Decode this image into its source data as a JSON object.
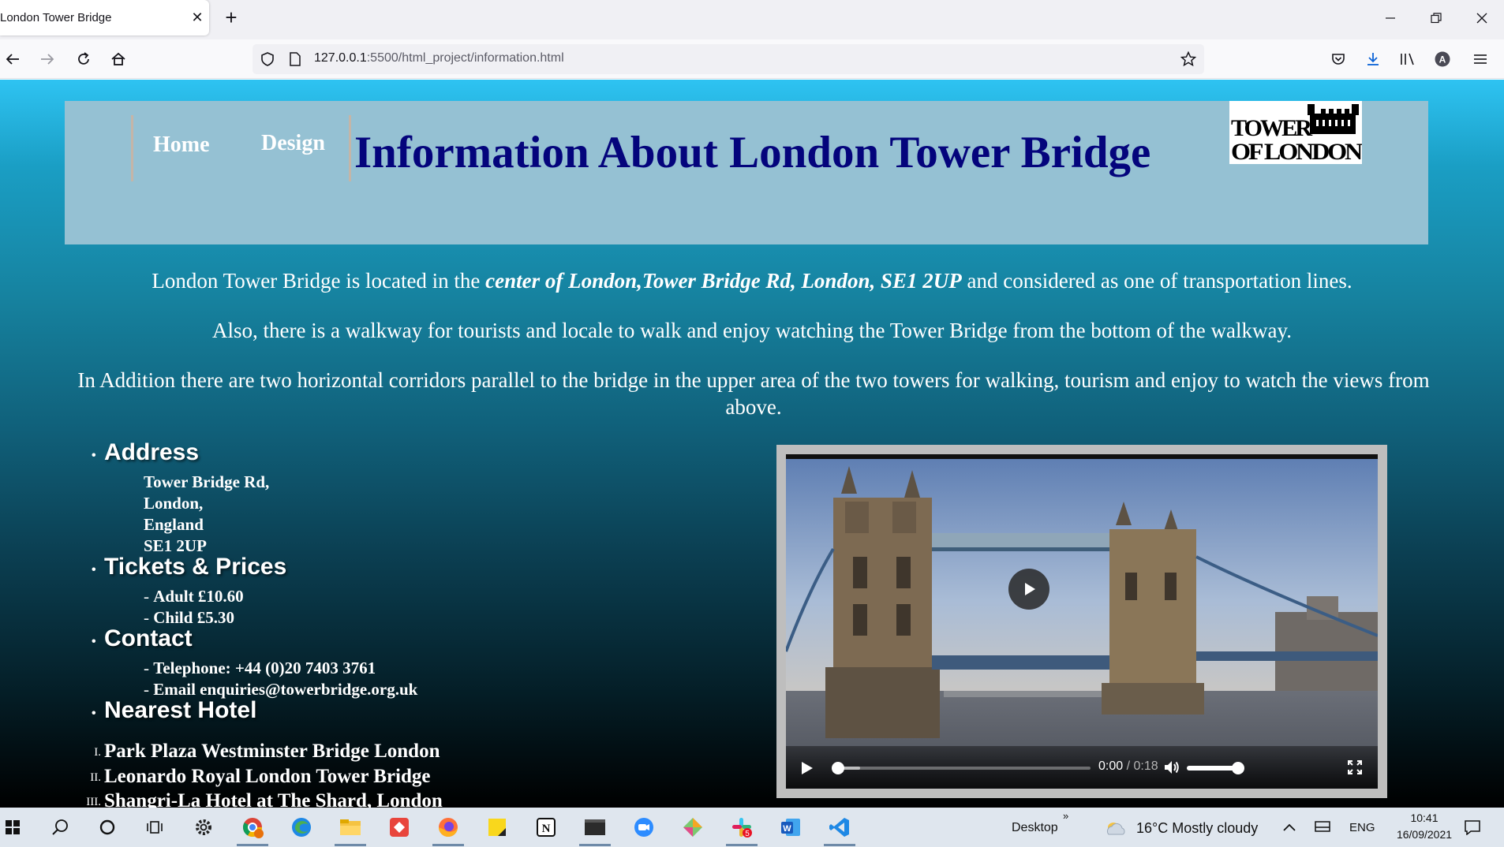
{
  "browser": {
    "tab_title": "London Tower Bridge",
    "tab_close": "✕",
    "new_tab": "+",
    "url_host": "127.0.0.1",
    "url_rest": ":5500/html_project/information.html"
  },
  "page": {
    "nav": {
      "home": "Home",
      "design": "Design"
    },
    "title": "Information About London Tower Bridge",
    "logo": {
      "line1": "TOWER",
      "line2": "OF LONDON"
    },
    "paragraphs": {
      "p1_start": "London Tower Bridge is located in the ",
      "p1_em": "center of London,Tower Bridge Rd, London, SE1 2UP",
      "p1_end": " and considered as one of transportation lines.",
      "p2": "Also, there is a walkway for tourists and locale to walk and enjoy watching the Tower Bridge from the bottom of the walkway.",
      "p3": "In Addition there are two horizontal corridors parallel to the bridge in the upper area of the two towers for walking, tourism and enjoy to watch the views from above."
    },
    "address": {
      "title": "Address",
      "lines": [
        "Tower Bridge Rd,",
        "London,",
        "England",
        "SE1 2UP"
      ]
    },
    "tickets": {
      "title": "Tickets & Prices",
      "items": [
        "Adult £10.60",
        "Child £5.30"
      ]
    },
    "contact": {
      "title": "Contact",
      "items": [
        "Telephone: +44 (0)20 7403 3761",
        "Email enquiries@towerbridge.org.uk"
      ]
    },
    "hotels": {
      "title": "Nearest Hotel",
      "numerals": [
        "I.",
        "II.",
        "III."
      ],
      "items": [
        "Park Plaza Westminster Bridge London",
        "Leonardo Royal London Tower Bridge",
        "Shangri-La Hotel at The Shard, London"
      ]
    },
    "video": {
      "time_current": "0:00",
      "time_sep": " / ",
      "time_total": "0:18",
      "progress": 0.0,
      "volume": 0.9
    }
  },
  "taskbar": {
    "desktop_label": "Desktop",
    "weather": "16°C  Mostly cloudy",
    "language": "ENG",
    "time": "10:41",
    "date": "16/09/2021",
    "slack_badge": "5"
  },
  "colors": {
    "title": "#04047c",
    "header_bg": "#95c1d3",
    "page_top": "#2ec3f2",
    "page_bottom": "#000000"
  }
}
